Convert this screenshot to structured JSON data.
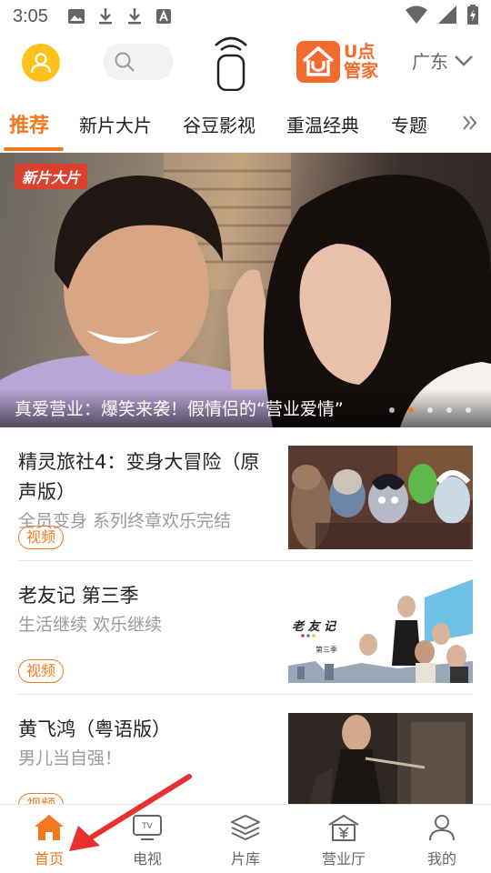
{
  "status": {
    "time": "3:05"
  },
  "header": {
    "region": "广东",
    "logo_line1": "U点",
    "logo_line2": "管家"
  },
  "tabs": [
    {
      "label": "推荐",
      "active": true
    },
    {
      "label": "新片大片"
    },
    {
      "label": "谷豆影视"
    },
    {
      "label": "重温经典"
    },
    {
      "label": "专题"
    }
  ],
  "banner": {
    "tag": "新片大片",
    "caption": "真爱营业：爆笑来袭！假情侣的“营业爱情”",
    "dots": 5,
    "active_dot": 2
  },
  "items": [
    {
      "title": "精灵旅社4：变身大冒险（原声版）",
      "subtitle": "全员变身 系列终章欢乐完结",
      "badge": "视频",
      "thumb_icon": "animated-monsters-thumbnail"
    },
    {
      "title": "老友记 第三季",
      "subtitle": "生活继续 欢乐继续",
      "badge": "视频",
      "thumb_icon": "friends-cast-thumbnail",
      "thumb_text": "老 友 记",
      "thumb_sub": "第三季"
    },
    {
      "title": "黄飞鸿（粤语版）",
      "subtitle": "男儿当自强！",
      "badge": "视频",
      "thumb_icon": "martial-arts-thumbnail"
    }
  ],
  "bottom_nav": [
    {
      "label": "首页",
      "icon": "home-icon",
      "active": true
    },
    {
      "label": "电视",
      "icon": "tv-icon"
    },
    {
      "label": "片库",
      "icon": "layers-icon"
    },
    {
      "label": "营业厅",
      "icon": "business-hall-icon"
    },
    {
      "label": "我的",
      "icon": "profile-icon"
    }
  ],
  "colors": {
    "accent": "#f2791e",
    "logo": "#f26a2e",
    "avatar": "#ffc21a",
    "annotation_arrow": "#e8312f"
  }
}
